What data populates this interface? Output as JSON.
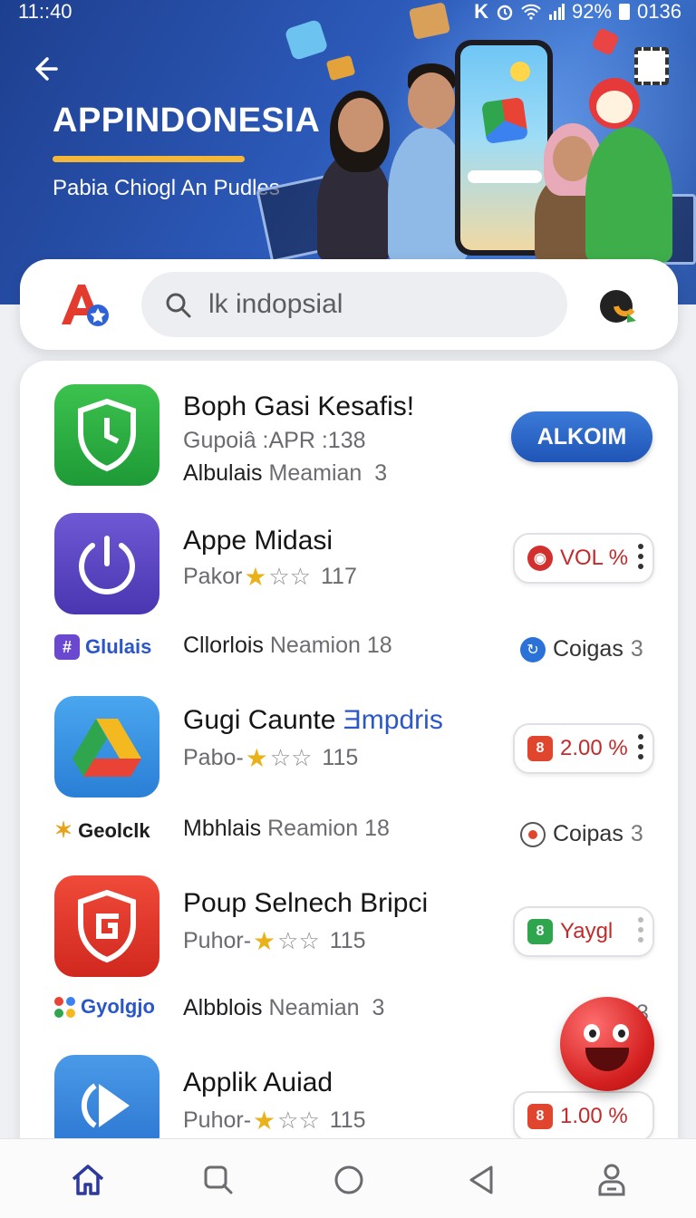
{
  "status_bar": {
    "time": "11::40",
    "battery": "92%",
    "extra": "0136",
    "icons": [
      "k-icon",
      "alarm-icon",
      "wifi-icon",
      "signal-icon",
      "battery-icon"
    ]
  },
  "header": {
    "brand": "APPINDONESIA",
    "tagline": "Pabia Chiogl An Pudles",
    "accent_color": "#f3b83a"
  },
  "search": {
    "placeholder": "lk indopsial"
  },
  "apps": [
    {
      "title": "Boph Gasi Kesafis!",
      "subtitle": "Gupoiâ :APR :138",
      "meta_main": "Albulais",
      "meta_light": "Meamian",
      "meta_count": "3",
      "action_label": "ALKOIM",
      "icon": "shield-check-icon"
    },
    {
      "title": "Appe Midasi",
      "rating_prefix": "Pakor",
      "rating_count": "117",
      "category": "Glulais",
      "meta_main": "Cllorlois",
      "meta_light": "Neamion",
      "meta_count": "18",
      "side_label": "Coigas",
      "side_count": "3",
      "pill_label": "VOL %",
      "icon": "power-icon"
    },
    {
      "title": "Gugi Caunte",
      "title_highlight": "Ǝmpdris",
      "rating_prefix": "Pabo-",
      "rating_count": "115",
      "category": "Geolclk",
      "meta_main": "Mbhlais",
      "meta_light": "Reamion",
      "meta_count": "18",
      "side_label": "Coipas",
      "side_count": "3",
      "pill_label": "2.00 %",
      "icon": "drive-triangle-icon"
    },
    {
      "title": "Poup Selnech Bripci",
      "rating_prefix": "Puhor-",
      "rating_count": "115",
      "category": "Gyolgjo",
      "meta_main": "Albblois",
      "meta_light": "Neamian",
      "meta_count": "3",
      "side_count": "3",
      "pill_label": "Yaygl",
      "icon": "shield-g-icon"
    },
    {
      "title": "Applik Auiad",
      "rating_prefix": "Puhor-",
      "rating_count": "115",
      "pill_label": "1.00 %",
      "icon": "play-icon"
    }
  ],
  "bottom_nav": [
    "home-icon",
    "search-icon",
    "circle-icon",
    "back-triangle-icon",
    "profile-icon"
  ]
}
